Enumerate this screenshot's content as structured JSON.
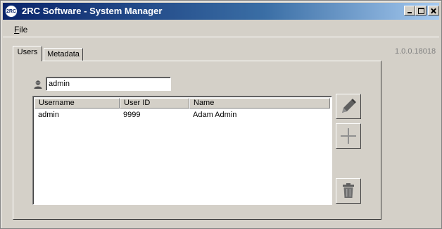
{
  "window": {
    "title": "2RC Software - System Manager",
    "icon_label": "2RC",
    "controls": [
      "minimize-icon",
      "maximize-icon",
      "close-icon"
    ]
  },
  "menu": {
    "file_mnemonic": "F",
    "file_rest": "ile"
  },
  "version": "1.0.0.18018",
  "tabs": [
    {
      "label": "Users",
      "selected": true
    },
    {
      "label": "Metadata",
      "selected": false
    }
  ],
  "search": {
    "value": "admin",
    "icon": "user-icon"
  },
  "users_table": {
    "columns": [
      "Username",
      "User ID",
      "Name"
    ],
    "rows": [
      {
        "username": "admin",
        "user_id": "9999",
        "name": "Adam Admin"
      }
    ]
  },
  "actions": {
    "edit_icon": "pencil-icon",
    "add_icon": "plus-icon",
    "delete_icon": "trash-icon"
  },
  "colors": {
    "titlebar_start": "#0a246a",
    "titlebar_end": "#a6caf0",
    "face": "#d4d0c8",
    "version_text": "#808080"
  }
}
